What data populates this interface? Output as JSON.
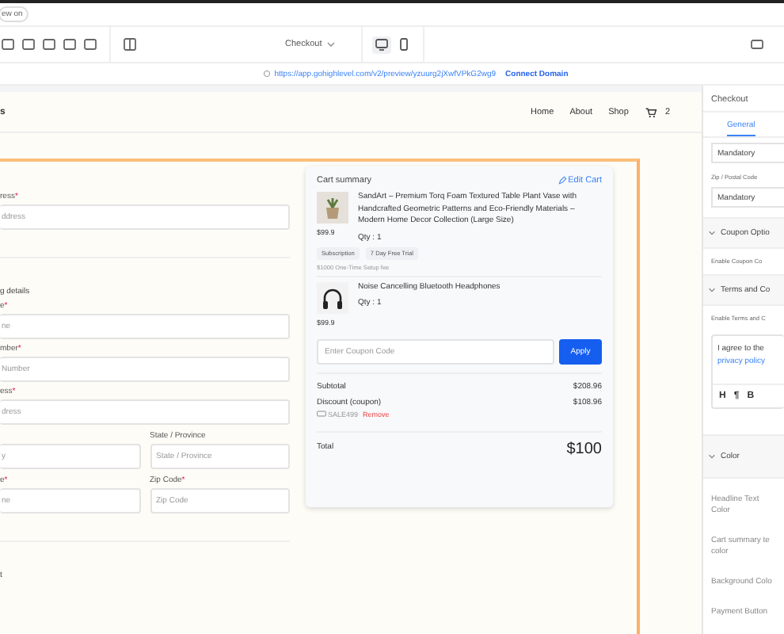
{
  "top_bar": {
    "pill": "ew on"
  },
  "toolbar": {
    "page_select": "Checkout",
    "devices": [
      {
        "kind": "desktop",
        "selected": true
      },
      {
        "kind": "mobile",
        "selected": false
      }
    ]
  },
  "url_bar": {
    "url": "https://app.gohighlevel.com/v2/preview/yzuurg2jXwfVPkG2wg9",
    "action": "Connect Domain"
  },
  "site_header": {
    "brand": "s",
    "nav": [
      "Home",
      "About",
      "Shop"
    ],
    "cart_count": "2"
  },
  "form": {
    "rows": [
      {
        "kind": "label",
        "text": "ress",
        "mark": "*"
      },
      {
        "kind": "field",
        "placeholder": "ddress"
      },
      {
        "kind": "divider"
      },
      {
        "kind": "heading",
        "text": "g details"
      },
      {
        "kind": "label",
        "text": "e",
        "mark": "*"
      },
      {
        "kind": "field",
        "placeholder": "ne"
      },
      {
        "kind": "label",
        "text": "mber",
        "mark": "*"
      },
      {
        "kind": "field",
        "placeholder": "Number"
      },
      {
        "kind": "label",
        "text": "ess",
        "mark": "*"
      },
      {
        "kind": "field",
        "placeholder": "dress"
      },
      {
        "kind": "pair",
        "left": {
          "placeholder": "y"
        },
        "right": {
          "label": "State / Province",
          "placeholder": "State / Province"
        }
      },
      {
        "kind": "pair",
        "left": {
          "label": "e",
          "mark": "*",
          "placeholder": "ne"
        },
        "right": {
          "label": "Zip Code",
          "mark": "*",
          "placeholder": "Zip Code"
        }
      },
      {
        "kind": "divider"
      },
      {
        "kind": "heading",
        "text": "t"
      }
    ]
  },
  "cart": {
    "title": "Cart summary",
    "edit": "Edit Cart",
    "items": [
      {
        "name": "SandArt – Premium Torq Foam Textured Table Plant Vase with Handcrafted Geometric Patterns and Eco-Friendly Materials – Modern Home Decor Collection (Large Size)",
        "qty": "Qty : 1",
        "price": "$99.9",
        "kind": "vase",
        "tags": [
          "Subscription",
          "7 Day Free Trial"
        ],
        "note": "$1000 One-Time Setup fee"
      },
      {
        "name": "Noise Cancelling Bluetooth Headphones",
        "qty": "Qty : 1",
        "price": "$99.9",
        "kind": "headphones"
      }
    ],
    "coupon_placeholder": "Enter Coupon Code",
    "apply": "Apply",
    "subtotal_label": "Subtotal",
    "subtotal": "$208.96",
    "discount_label": "Discount (coupon)",
    "discount": "$108.96",
    "code": "SALE499",
    "remove": "Remove",
    "total_label": "Total",
    "total": "$100"
  },
  "panel": {
    "title": "Checkout",
    "tabs": [
      {
        "label": "General",
        "selected": true
      }
    ],
    "field1": "Mandatory",
    "zip_label": "Zip / Postal Code",
    "field2": "Mandatory",
    "coupon_section": "Coupon Optio",
    "coupon_toggle": "Enable Coupon Co",
    "terms_section": "Terms and Co",
    "terms_toggle": "Enable Terms and C",
    "terms_text": "I agree to the ",
    "terms_link": "privacy policy",
    "editor_tools": [
      "H",
      "¶",
      "B"
    ],
    "color_section": "Color",
    "color_rows": [
      "Headline Text Color",
      "Cart summary te color",
      "Background Colo",
      "Payment Button"
    ]
  }
}
